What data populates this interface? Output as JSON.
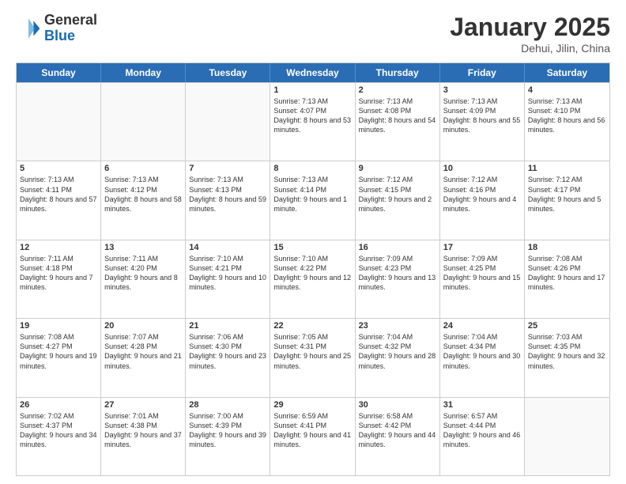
{
  "header": {
    "logo_general": "General",
    "logo_blue": "Blue",
    "title": "January 2025",
    "location": "Dehui, Jilin, China"
  },
  "weekdays": [
    "Sunday",
    "Monday",
    "Tuesday",
    "Wednesday",
    "Thursday",
    "Friday",
    "Saturday"
  ],
  "weeks": [
    [
      {
        "day": "",
        "text": "",
        "empty": true
      },
      {
        "day": "",
        "text": "",
        "empty": true
      },
      {
        "day": "",
        "text": "",
        "empty": true
      },
      {
        "day": "1",
        "text": "Sunrise: 7:13 AM\nSunset: 4:07 PM\nDaylight: 8 hours and 53 minutes."
      },
      {
        "day": "2",
        "text": "Sunrise: 7:13 AM\nSunset: 4:08 PM\nDaylight: 8 hours and 54 minutes."
      },
      {
        "day": "3",
        "text": "Sunrise: 7:13 AM\nSunset: 4:09 PM\nDaylight: 8 hours and 55 minutes."
      },
      {
        "day": "4",
        "text": "Sunrise: 7:13 AM\nSunset: 4:10 PM\nDaylight: 8 hours and 56 minutes."
      }
    ],
    [
      {
        "day": "5",
        "text": "Sunrise: 7:13 AM\nSunset: 4:11 PM\nDaylight: 8 hours and 57 minutes."
      },
      {
        "day": "6",
        "text": "Sunrise: 7:13 AM\nSunset: 4:12 PM\nDaylight: 8 hours and 58 minutes."
      },
      {
        "day": "7",
        "text": "Sunrise: 7:13 AM\nSunset: 4:13 PM\nDaylight: 8 hours and 59 minutes."
      },
      {
        "day": "8",
        "text": "Sunrise: 7:13 AM\nSunset: 4:14 PM\nDaylight: 9 hours and 1 minute."
      },
      {
        "day": "9",
        "text": "Sunrise: 7:12 AM\nSunset: 4:15 PM\nDaylight: 9 hours and 2 minutes."
      },
      {
        "day": "10",
        "text": "Sunrise: 7:12 AM\nSunset: 4:16 PM\nDaylight: 9 hours and 4 minutes."
      },
      {
        "day": "11",
        "text": "Sunrise: 7:12 AM\nSunset: 4:17 PM\nDaylight: 9 hours and 5 minutes."
      }
    ],
    [
      {
        "day": "12",
        "text": "Sunrise: 7:11 AM\nSunset: 4:18 PM\nDaylight: 9 hours and 7 minutes."
      },
      {
        "day": "13",
        "text": "Sunrise: 7:11 AM\nSunset: 4:20 PM\nDaylight: 9 hours and 8 minutes."
      },
      {
        "day": "14",
        "text": "Sunrise: 7:10 AM\nSunset: 4:21 PM\nDaylight: 9 hours and 10 minutes."
      },
      {
        "day": "15",
        "text": "Sunrise: 7:10 AM\nSunset: 4:22 PM\nDaylight: 9 hours and 12 minutes."
      },
      {
        "day": "16",
        "text": "Sunrise: 7:09 AM\nSunset: 4:23 PM\nDaylight: 9 hours and 13 minutes."
      },
      {
        "day": "17",
        "text": "Sunrise: 7:09 AM\nSunset: 4:25 PM\nDaylight: 9 hours and 15 minutes."
      },
      {
        "day": "18",
        "text": "Sunrise: 7:08 AM\nSunset: 4:26 PM\nDaylight: 9 hours and 17 minutes."
      }
    ],
    [
      {
        "day": "19",
        "text": "Sunrise: 7:08 AM\nSunset: 4:27 PM\nDaylight: 9 hours and 19 minutes."
      },
      {
        "day": "20",
        "text": "Sunrise: 7:07 AM\nSunset: 4:28 PM\nDaylight: 9 hours and 21 minutes."
      },
      {
        "day": "21",
        "text": "Sunrise: 7:06 AM\nSunset: 4:30 PM\nDaylight: 9 hours and 23 minutes."
      },
      {
        "day": "22",
        "text": "Sunrise: 7:05 AM\nSunset: 4:31 PM\nDaylight: 9 hours and 25 minutes."
      },
      {
        "day": "23",
        "text": "Sunrise: 7:04 AM\nSunset: 4:32 PM\nDaylight: 9 hours and 28 minutes."
      },
      {
        "day": "24",
        "text": "Sunrise: 7:04 AM\nSunset: 4:34 PM\nDaylight: 9 hours and 30 minutes."
      },
      {
        "day": "25",
        "text": "Sunrise: 7:03 AM\nSunset: 4:35 PM\nDaylight: 9 hours and 32 minutes."
      }
    ],
    [
      {
        "day": "26",
        "text": "Sunrise: 7:02 AM\nSunset: 4:37 PM\nDaylight: 9 hours and 34 minutes."
      },
      {
        "day": "27",
        "text": "Sunrise: 7:01 AM\nSunset: 4:38 PM\nDaylight: 9 hours and 37 minutes."
      },
      {
        "day": "28",
        "text": "Sunrise: 7:00 AM\nSunset: 4:39 PM\nDaylight: 9 hours and 39 minutes."
      },
      {
        "day": "29",
        "text": "Sunrise: 6:59 AM\nSunset: 4:41 PM\nDaylight: 9 hours and 41 minutes."
      },
      {
        "day": "30",
        "text": "Sunrise: 6:58 AM\nSunset: 4:42 PM\nDaylight: 9 hours and 44 minutes."
      },
      {
        "day": "31",
        "text": "Sunrise: 6:57 AM\nSunset: 4:44 PM\nDaylight: 9 hours and 46 minutes."
      },
      {
        "day": "",
        "text": "",
        "empty": true
      }
    ]
  ]
}
